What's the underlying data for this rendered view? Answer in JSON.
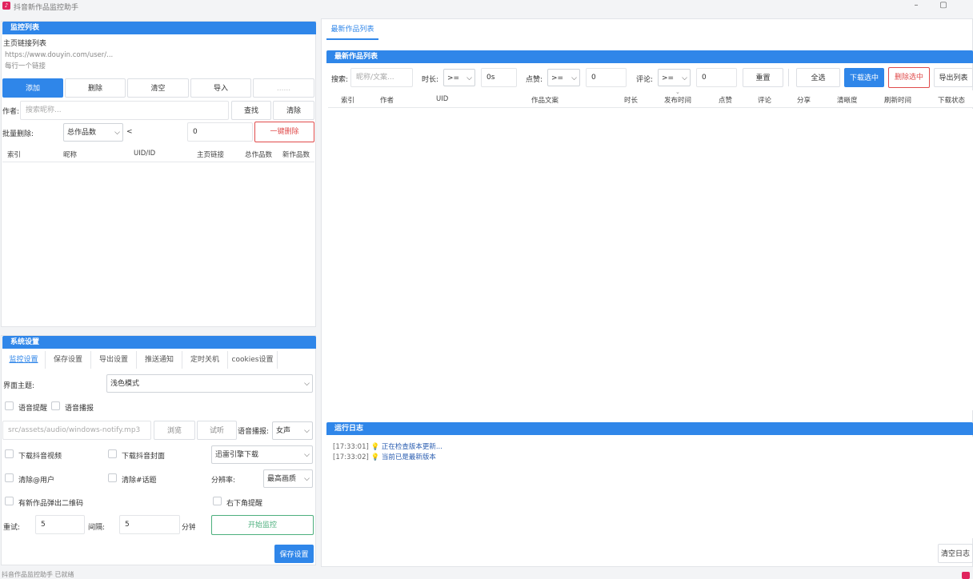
{
  "window": {
    "title": "抖音新作品监控助手",
    "min": "–",
    "max": "▢"
  },
  "monitor": {
    "header": "监控列表",
    "url_label": "主页链接列表",
    "url_placeholder_line1": "https://www.douyin.com/user/...",
    "url_placeholder_line2": "每行一个链接",
    "buttons": {
      "add": "添加",
      "delete": "删除",
      "clear": "清空",
      "import": "导入",
      "more": "......"
    },
    "author_label": "作者:",
    "author_placeholder": "搜索昵称...",
    "find": "查找",
    "clear_search": "清除",
    "batch_label": "批量删除:",
    "batch_select": "总作品数",
    "batch_op": "<",
    "batch_value": "0",
    "batch_btn": "一键删除",
    "columns": [
      "索引",
      "昵称",
      "UID/ID",
      "主页链接",
      "总作品数",
      "新作品数"
    ]
  },
  "settings": {
    "header": "系统设置",
    "tabs": [
      "监控设置",
      "保存设置",
      "导出设置",
      "推送通知",
      "定时关机",
      "cookies设置"
    ],
    "theme_label": "界面主题:",
    "theme_value": "浅色模式",
    "voice_remind": "语音提醒",
    "voice_broadcast": "语音播报",
    "audio_path": "src/assets/audio/windows-notify.mp3",
    "browse": "浏览",
    "test": "试听",
    "voice_label": "语音播报:",
    "voice_value": "女声",
    "download_video": "下载抖音视频",
    "download_cover": "下载抖音封面",
    "download_engine": "迅雷引擎下载",
    "clear_at": "清除@用户",
    "clear_topic": "清除#话题",
    "resolution_label": "分辨率:",
    "resolution_value": "最高画质",
    "qrcode": "有新作品弹出二维码",
    "corner": "右下角提醒",
    "retry_label": "重试:",
    "retry_value": "5",
    "interval_label": "间隔:",
    "interval_value": "5",
    "interval_unit": "分钟",
    "start_btn": "开始监控",
    "save_btn": "保存设置"
  },
  "latest": {
    "tab": "最新作品列表",
    "header": "最新作品列表",
    "search_label": "搜索:",
    "search_placeholder": "昵称/文案...",
    "duration_label": "时长:",
    "duration_op": ">=",
    "duration_value": "0s",
    "likes_label": "点赞:",
    "likes_op": ">=",
    "likes_value": "0",
    "comments_label": "评论:",
    "comments_op": ">=",
    "comments_value": "0",
    "reset": "重置",
    "select_all": "全选",
    "download_selected": "下载选中",
    "delete_selected": "删除选中",
    "export": "导出列表",
    "columns": [
      "索引",
      "作者",
      "UID",
      "作品文案",
      "时长",
      "发布时间",
      "点赞",
      "评论",
      "分享",
      "清晰度",
      "刷新时间",
      "下载状态"
    ]
  },
  "log": {
    "header": "运行日志",
    "lines": [
      {
        "time": "[17:33:01]",
        "icon": "lightbulb-icon",
        "text": "正在检查版本更新..."
      },
      {
        "time": "[17:33:02]",
        "icon": "lightbulb-icon",
        "text": "当前已是最新版本"
      }
    ],
    "clear": "清空日志"
  },
  "status": "抖音作品监控助手 已就绪"
}
